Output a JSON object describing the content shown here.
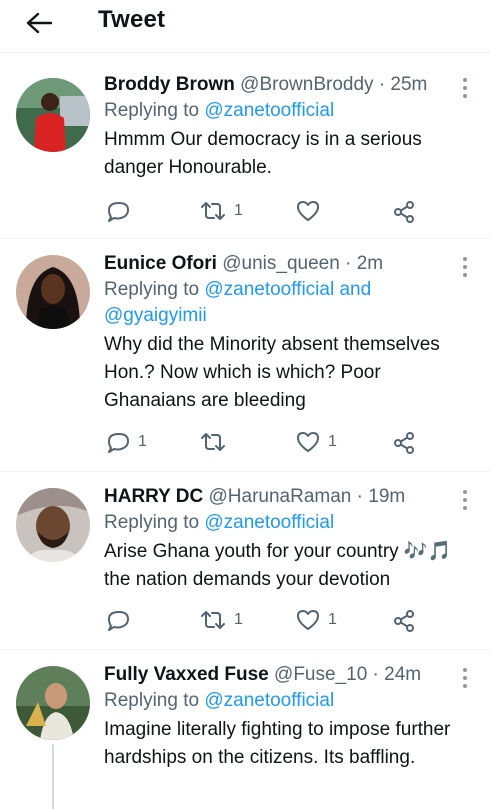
{
  "header": {
    "title": "Tweet"
  },
  "tweets": [
    {
      "name": "Broddy Brown",
      "handle": "@BrownBroddy",
      "sep": "·",
      "time": "25m",
      "reply_prefix": "Replying to",
      "reply_mentions": "@zanetoofficial",
      "text": "Hmmm Our democracy is in a serious danger Honourable.",
      "replies": "",
      "retweets": "1",
      "likes": ""
    },
    {
      "name": "Eunice Ofori",
      "handle": "@unis_queen",
      "sep": "·",
      "time": "2m",
      "reply_prefix": "Replying to",
      "reply_mentions": "@zanetoofficial and @gyaigyimii",
      "text": "Why did the Minority absent themselves Hon.? Now which is which? Poor Ghanaians are bleeding",
      "replies": "1",
      "retweets": "",
      "likes": "1"
    },
    {
      "name": "HARRY DC",
      "handle": "@HarunaRaman",
      "sep": "·",
      "time": "19m",
      "reply_prefix": "Replying to",
      "reply_mentions": "@zanetoofficial",
      "text": "Arise Ghana youth for your country 🎶🎵 the nation demands your devotion",
      "replies": "",
      "retweets": "1",
      "likes": "1"
    },
    {
      "name": "Fully Vaxxed Fuse",
      "handle": "@Fuse_10",
      "sep": "·",
      "time": "24m",
      "reply_prefix": "Replying to",
      "reply_mentions": "@zanetoofficial",
      "text": "Imagine literally fighting to impose further hardships on the citizens. Its baffling.",
      "replies": "",
      "retweets": "",
      "likes": ""
    }
  ]
}
